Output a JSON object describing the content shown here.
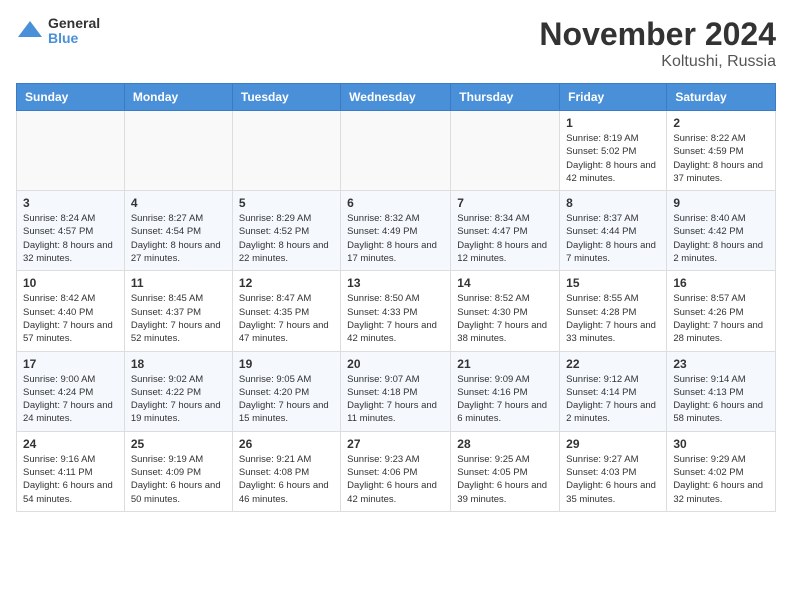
{
  "logo": {
    "general": "General",
    "blue": "Blue"
  },
  "title": "November 2024",
  "location": "Koltushi, Russia",
  "days_header": [
    "Sunday",
    "Monday",
    "Tuesday",
    "Wednesday",
    "Thursday",
    "Friday",
    "Saturday"
  ],
  "weeks": [
    [
      {
        "day": "",
        "info": ""
      },
      {
        "day": "",
        "info": ""
      },
      {
        "day": "",
        "info": ""
      },
      {
        "day": "",
        "info": ""
      },
      {
        "day": "",
        "info": ""
      },
      {
        "day": "1",
        "info": "Sunrise: 8:19 AM\nSunset: 5:02 PM\nDaylight: 8 hours and 42 minutes."
      },
      {
        "day": "2",
        "info": "Sunrise: 8:22 AM\nSunset: 4:59 PM\nDaylight: 8 hours and 37 minutes."
      }
    ],
    [
      {
        "day": "3",
        "info": "Sunrise: 8:24 AM\nSunset: 4:57 PM\nDaylight: 8 hours and 32 minutes."
      },
      {
        "day": "4",
        "info": "Sunrise: 8:27 AM\nSunset: 4:54 PM\nDaylight: 8 hours and 27 minutes."
      },
      {
        "day": "5",
        "info": "Sunrise: 8:29 AM\nSunset: 4:52 PM\nDaylight: 8 hours and 22 minutes."
      },
      {
        "day": "6",
        "info": "Sunrise: 8:32 AM\nSunset: 4:49 PM\nDaylight: 8 hours and 17 minutes."
      },
      {
        "day": "7",
        "info": "Sunrise: 8:34 AM\nSunset: 4:47 PM\nDaylight: 8 hours and 12 minutes."
      },
      {
        "day": "8",
        "info": "Sunrise: 8:37 AM\nSunset: 4:44 PM\nDaylight: 8 hours and 7 minutes."
      },
      {
        "day": "9",
        "info": "Sunrise: 8:40 AM\nSunset: 4:42 PM\nDaylight: 8 hours and 2 minutes."
      }
    ],
    [
      {
        "day": "10",
        "info": "Sunrise: 8:42 AM\nSunset: 4:40 PM\nDaylight: 7 hours and 57 minutes."
      },
      {
        "day": "11",
        "info": "Sunrise: 8:45 AM\nSunset: 4:37 PM\nDaylight: 7 hours and 52 minutes."
      },
      {
        "day": "12",
        "info": "Sunrise: 8:47 AM\nSunset: 4:35 PM\nDaylight: 7 hours and 47 minutes."
      },
      {
        "day": "13",
        "info": "Sunrise: 8:50 AM\nSunset: 4:33 PM\nDaylight: 7 hours and 42 minutes."
      },
      {
        "day": "14",
        "info": "Sunrise: 8:52 AM\nSunset: 4:30 PM\nDaylight: 7 hours and 38 minutes."
      },
      {
        "day": "15",
        "info": "Sunrise: 8:55 AM\nSunset: 4:28 PM\nDaylight: 7 hours and 33 minutes."
      },
      {
        "day": "16",
        "info": "Sunrise: 8:57 AM\nSunset: 4:26 PM\nDaylight: 7 hours and 28 minutes."
      }
    ],
    [
      {
        "day": "17",
        "info": "Sunrise: 9:00 AM\nSunset: 4:24 PM\nDaylight: 7 hours and 24 minutes."
      },
      {
        "day": "18",
        "info": "Sunrise: 9:02 AM\nSunset: 4:22 PM\nDaylight: 7 hours and 19 minutes."
      },
      {
        "day": "19",
        "info": "Sunrise: 9:05 AM\nSunset: 4:20 PM\nDaylight: 7 hours and 15 minutes."
      },
      {
        "day": "20",
        "info": "Sunrise: 9:07 AM\nSunset: 4:18 PM\nDaylight: 7 hours and 11 minutes."
      },
      {
        "day": "21",
        "info": "Sunrise: 9:09 AM\nSunset: 4:16 PM\nDaylight: 7 hours and 6 minutes."
      },
      {
        "day": "22",
        "info": "Sunrise: 9:12 AM\nSunset: 4:14 PM\nDaylight: 7 hours and 2 minutes."
      },
      {
        "day": "23",
        "info": "Sunrise: 9:14 AM\nSunset: 4:13 PM\nDaylight: 6 hours and 58 minutes."
      }
    ],
    [
      {
        "day": "24",
        "info": "Sunrise: 9:16 AM\nSunset: 4:11 PM\nDaylight: 6 hours and 54 minutes."
      },
      {
        "day": "25",
        "info": "Sunrise: 9:19 AM\nSunset: 4:09 PM\nDaylight: 6 hours and 50 minutes."
      },
      {
        "day": "26",
        "info": "Sunrise: 9:21 AM\nSunset: 4:08 PM\nDaylight: 6 hours and 46 minutes."
      },
      {
        "day": "27",
        "info": "Sunrise: 9:23 AM\nSunset: 4:06 PM\nDaylight: 6 hours and 42 minutes."
      },
      {
        "day": "28",
        "info": "Sunrise: 9:25 AM\nSunset: 4:05 PM\nDaylight: 6 hours and 39 minutes."
      },
      {
        "day": "29",
        "info": "Sunrise: 9:27 AM\nSunset: 4:03 PM\nDaylight: 6 hours and 35 minutes."
      },
      {
        "day": "30",
        "info": "Sunrise: 9:29 AM\nSunset: 4:02 PM\nDaylight: 6 hours and 32 minutes."
      }
    ]
  ]
}
